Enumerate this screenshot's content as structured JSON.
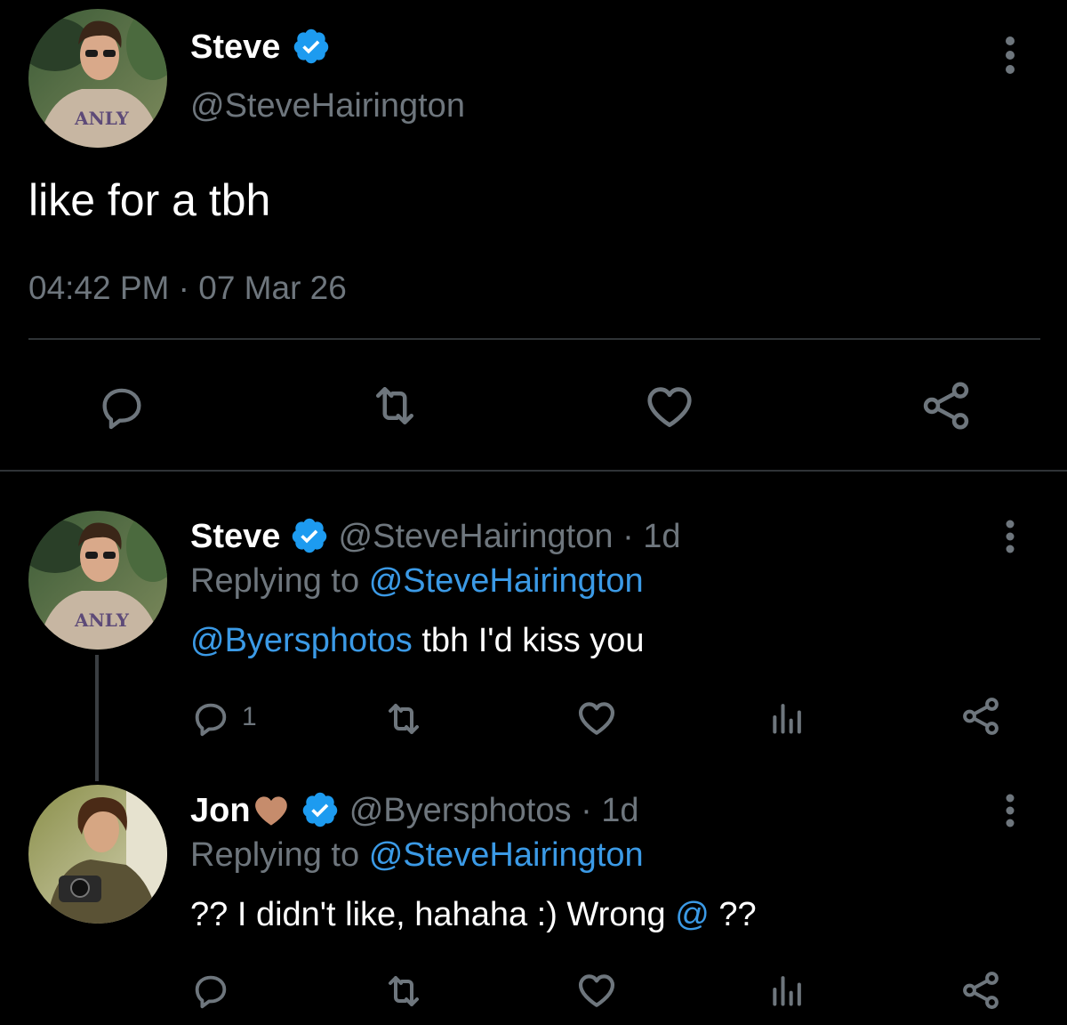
{
  "colors": {
    "background": "#000000",
    "primary_text": "#ffffff",
    "muted_text": "#6e767d",
    "link": "#3b9ae6",
    "verified_badge": "#1d9bf0",
    "divider": "#2f3336",
    "heart_emoji": "#c68c6c"
  },
  "main_tweet": {
    "author": {
      "name": "Steve",
      "handle": "@SteveHairington",
      "verified": true,
      "avatar_icon": "avatar-steve"
    },
    "text": "like for a tbh",
    "timestamp": "04:42 PM · 07 Mar 26",
    "actions": [
      "reply-icon",
      "retweet-icon",
      "like-icon",
      "share-icon"
    ],
    "more_icon": "more-vertical-icon"
  },
  "replies": [
    {
      "author": {
        "name": "Steve",
        "handle": "@SteveHairington",
        "verified": true,
        "avatar_icon": "avatar-steve"
      },
      "time": "· 1d",
      "replying_prefix": "Replying to",
      "replying_to": "@SteveHairington",
      "mention": "@Byersphotos",
      "text": " tbh I'd kiss you",
      "reply_count": "1",
      "actions": [
        "reply-icon",
        "retweet-icon",
        "like-icon",
        "analytics-icon",
        "share-icon"
      ]
    },
    {
      "author": {
        "name": "Jon",
        "name_emoji": "brown-heart-icon",
        "handle": "@Byersphotos",
        "verified": true,
        "avatar_icon": "avatar-jon"
      },
      "time": "· 1d",
      "replying_prefix": "Replying to",
      "replying_to": "@SteveHairington",
      "text_before": "?? I didn't like, hahaha :) Wrong ",
      "text_link": "@",
      "text_after": " ??",
      "actions": [
        "reply-icon",
        "retweet-icon",
        "like-icon",
        "analytics-icon",
        "share-icon"
      ]
    }
  ]
}
